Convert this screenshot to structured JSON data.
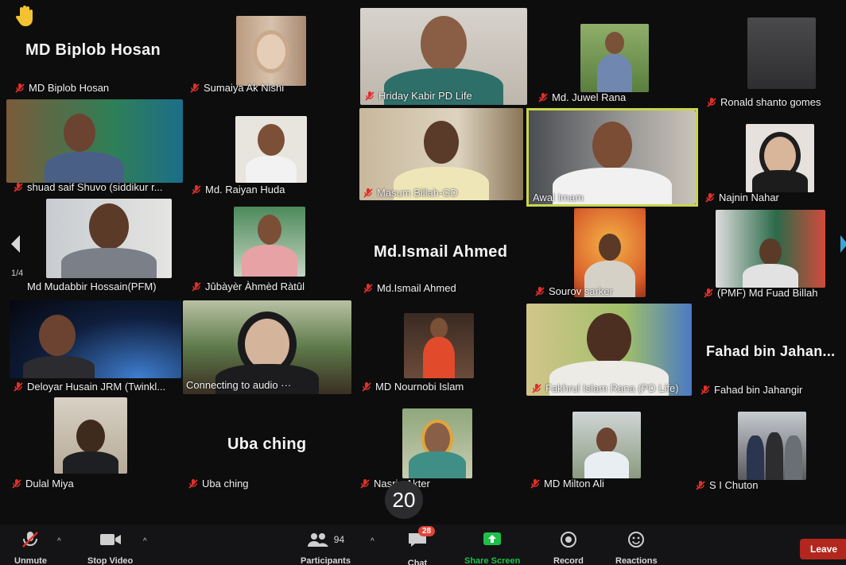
{
  "meeting": {
    "page_indicator": "1/4",
    "speaker_counter": "20"
  },
  "tiles": [
    {
      "id": "biplob",
      "label": "MD Biplob Hosan",
      "big_name": "MD Biplob Hosan"
    },
    {
      "id": "sumaiya",
      "label": "Sumaiya Ak Nishi"
    },
    {
      "id": "hriday",
      "label": "Hriday Kabir PD Life"
    },
    {
      "id": "juwel",
      "label": "Md. Juwel Rana"
    },
    {
      "id": "ronald",
      "label": "Ronald shanto gomes"
    },
    {
      "id": "shuad",
      "label": "shuad saif Shuvo (siddikur r..."
    },
    {
      "id": "raiyan",
      "label": "Md. Raiyan Huda"
    },
    {
      "id": "masum",
      "label": "Masum Billah-GD"
    },
    {
      "id": "awal",
      "label": "Awal Imam"
    },
    {
      "id": "najnin",
      "label": "Najnin Nahar"
    },
    {
      "id": "mudabbir",
      "label": "Md Mudabbir Hossain(PFM)"
    },
    {
      "id": "jubayer",
      "label": "Jûbàyèr Àhmèd Ràtûl"
    },
    {
      "id": "ismail",
      "label": "Md.Ismail Ahmed",
      "big_name": "Md.Ismail Ahmed"
    },
    {
      "id": "sourov",
      "label": "Sourov sarker"
    },
    {
      "id": "fuad",
      "label": "(PMF) Md Fuad Billah"
    },
    {
      "id": "deloyar",
      "label": "Deloyar Husain JRM (Twinkl..."
    },
    {
      "id": "connecting",
      "label": "Connecting to audio ···"
    },
    {
      "id": "nournobi",
      "label": "MD Nournobi Islam"
    },
    {
      "id": "fakhrul",
      "label": "Fakhrul Islam Rana (PD Life)"
    },
    {
      "id": "fahad",
      "label": "Fahad bin Jahangir",
      "big_name": "Fahad bin Jahan..."
    },
    {
      "id": "dulal",
      "label": "Dulal Miya"
    },
    {
      "id": "uba",
      "label": "Uba ching",
      "big_name": "Uba ching"
    },
    {
      "id": "nasrin",
      "label": "Nasrin Akter"
    },
    {
      "id": "milton",
      "label": "MD Milton Ali"
    },
    {
      "id": "chuton",
      "label": "S I Chuton"
    }
  ],
  "toolbar": {
    "unmute": "Unmute",
    "stop_video": "Stop Video",
    "participants": "Participants",
    "participants_count": "94",
    "chat": "Chat",
    "chat_badge": "28",
    "share_screen": "Share Screen",
    "record": "Record",
    "reactions": "Reactions",
    "leave": "Leave"
  },
  "colors": {
    "accent_green": "#1fbf4a",
    "active_speaker": "#c9d64a",
    "muted_red": "#e0302a",
    "leave_red": "#b3261e"
  }
}
